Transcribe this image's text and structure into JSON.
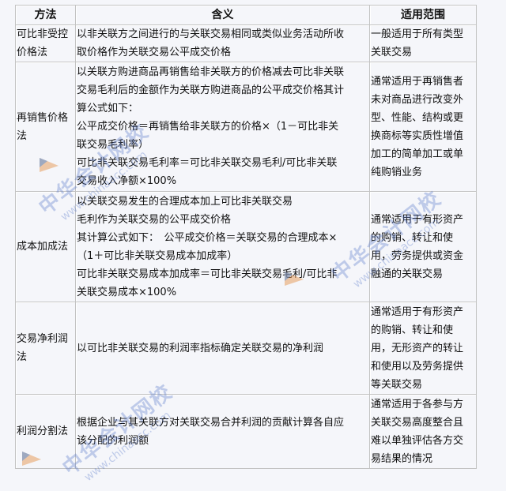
{
  "table": {
    "headers": [
      "方法",
      "含义",
      "适用范围"
    ],
    "rows": [
      {
        "method": [
          "可比非受控",
          "价格法"
        ],
        "meaning": [
          "以非关联方之间进行的与关联交易相同或类似业务活动所收",
          "取价格作为关联交易公平成交价格"
        ],
        "scope": [
          "一般适用于所有类型",
          "关联交易"
        ]
      },
      {
        "method": [
          "再销售价格",
          "法"
        ],
        "meaning": [
          "以关联方购进商品再销售给非关联方的价格减去可比非关联",
          "交易毛利后的金额作为关联方购进商品的公平成交价格其计",
          "算公式如下：",
          "公平成交价格＝再销售给非关联方的价格×（1－可比非关",
          "联交易毛利率）",
          "可比非关联交易毛利率＝可比非关联交易毛利/可比非关联",
          "交易收入净额×100%"
        ],
        "scope": [
          "通常适用于再销售者",
          "未对商品进行改变外",
          "型、性能、结构或更",
          "换商标等实质性增值",
          "加工的简单加工或单",
          "纯购销业务"
        ]
      },
      {
        "method": [
          "成本加成法"
        ],
        "meaning": [
          "以关联交易发生的合理成本加上可比非关联交易",
          "毛利作为关联交易的公平成交价格",
          "其计算公式如下：　公平成交价格＝关联交易的合理成本×",
          "（1＋可比非关联交易成本加成率）",
          "可比非关联交易成本加成率＝可比非关联交易毛利/可比非",
          "关联交易成本×100%"
        ],
        "scope": [
          "通常适用于有形资产",
          "的购销、转让和使",
          "用，劳务提供或资金",
          "融通的关联交易"
        ]
      },
      {
        "method": [
          "交易净利润",
          "法"
        ],
        "meaning": [
          "以可比非关联交易的利润率指标确定关联交易的净利润"
        ],
        "scope": [
          "通常适用于有形资产",
          "的购销、转让和使",
          "用，无形资产的转让",
          "和使用以及劳务提供",
          "等关联交易"
        ]
      },
      {
        "method": [
          "利润分割法"
        ],
        "meaning": [
          "根据企业与其关联方对关联交易合并利润的贡献计算各自应",
          "该分配的利润额"
        ],
        "scope": [
          "通常适用于各参与方",
          "关联交易高度整合且",
          "难以单独评估各方交",
          "易结果的情况"
        ]
      }
    ]
  },
  "watermark": {
    "name": "中华会计网校",
    "url": "www.chinaacc.com"
  }
}
